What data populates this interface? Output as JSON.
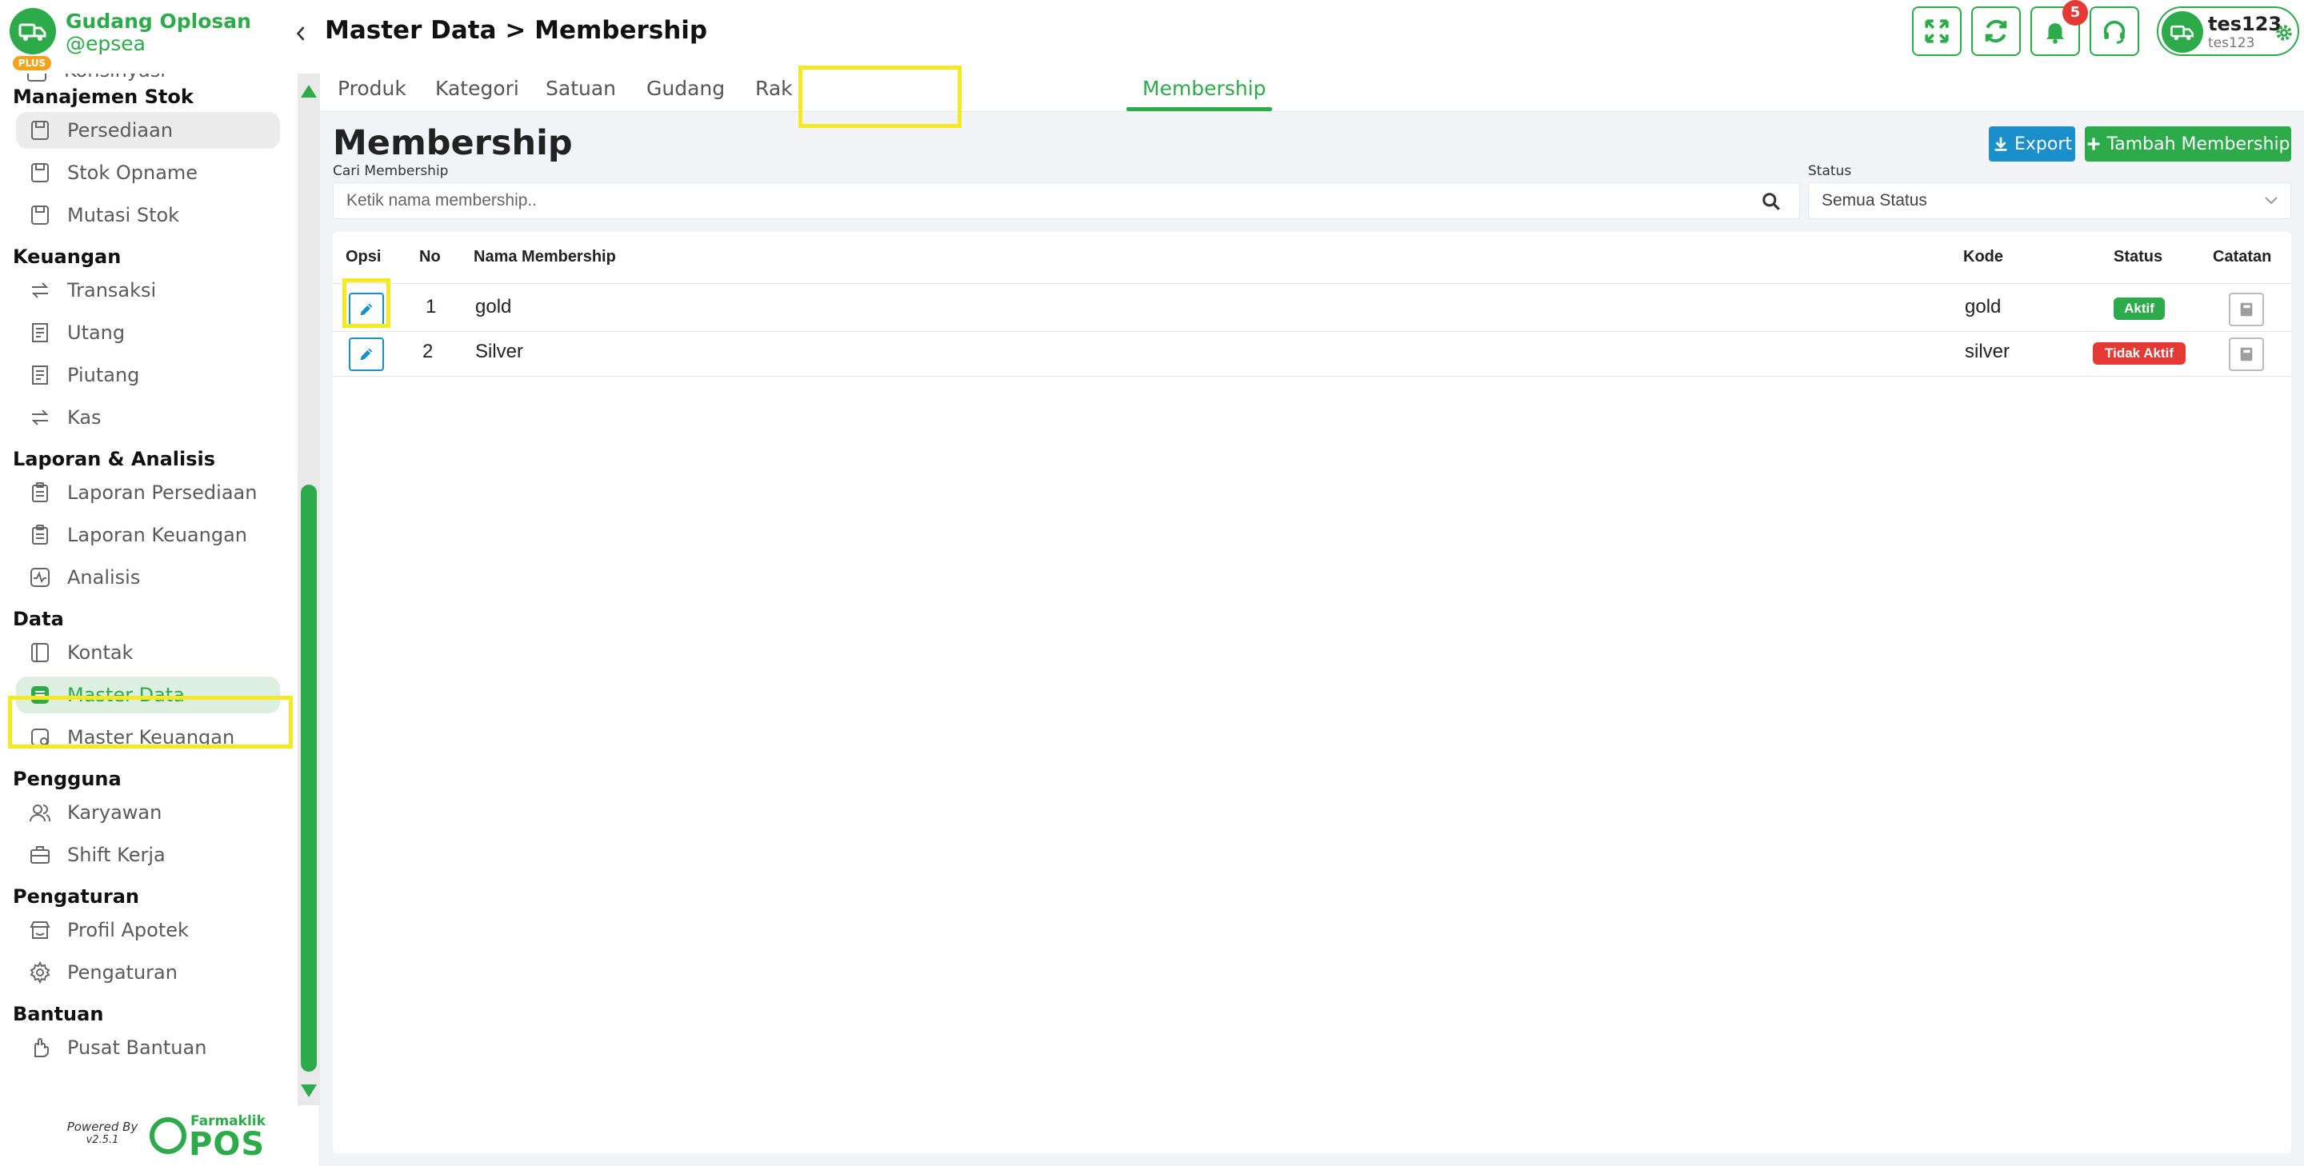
{
  "brand": {
    "name": "Gudang Oplosan",
    "handle": "@epsea",
    "plan": "PLUS"
  },
  "sidebar": {
    "partial_item": "Konsinyasi",
    "sections": [
      {
        "title": "Manajemen Stok",
        "items": [
          {
            "label": "Persediaan",
            "icon": "save-icon",
            "state": "hover"
          },
          {
            "label": "Stok Opname",
            "icon": "save-icon"
          },
          {
            "label": "Mutasi Stok",
            "icon": "save-icon"
          }
        ]
      },
      {
        "title": "Keuangan",
        "items": [
          {
            "label": "Transaksi",
            "icon": "transfer-icon"
          },
          {
            "label": "Utang",
            "icon": "receipt-icon"
          },
          {
            "label": "Piutang",
            "icon": "receipt-icon"
          },
          {
            "label": "Kas",
            "icon": "transfer-icon"
          }
        ]
      },
      {
        "title": "Laporan & Analisis",
        "items": [
          {
            "label": "Laporan Persediaan",
            "icon": "clipboard-icon"
          },
          {
            "label": "Laporan Keuangan",
            "icon": "clipboard-icon"
          },
          {
            "label": "Analisis",
            "icon": "activity-icon"
          }
        ]
      },
      {
        "title": "Data",
        "items": [
          {
            "label": "Kontak",
            "icon": "contact-book-icon"
          },
          {
            "label": "Master Data",
            "icon": "database-icon",
            "state": "active"
          },
          {
            "label": "Master Keuangan",
            "icon": "wallet-icon"
          }
        ]
      },
      {
        "title": "Pengguna",
        "items": [
          {
            "label": "Karyawan",
            "icon": "users-icon"
          },
          {
            "label": "Shift Kerja",
            "icon": "briefcase-icon"
          }
        ]
      },
      {
        "title": "Pengaturan",
        "items": [
          {
            "label": "Profil Apotek",
            "icon": "store-icon"
          },
          {
            "label": "Pengaturan",
            "icon": "gear-icon"
          }
        ]
      },
      {
        "title": "Bantuan",
        "items": [
          {
            "label": "Pusat Bantuan",
            "icon": "hand-icon"
          }
        ]
      }
    ],
    "powered_by": "Powered By",
    "version": "v2.5.1",
    "partner_small": "Farmaklik",
    "partner_big": "POS"
  },
  "header": {
    "title": "Master Data > Membership",
    "notification_count": "5",
    "user_name": "tes123",
    "user_sub": "tes123"
  },
  "tabs": [
    {
      "label": "Produk"
    },
    {
      "label": "Kategori"
    },
    {
      "label": "Satuan"
    },
    {
      "label": "Gudang"
    },
    {
      "label": "Rak"
    },
    {
      "label": "Membership",
      "active": true
    }
  ],
  "main": {
    "title": "Membership",
    "export_label": "Export",
    "add_label": "Tambah Membership",
    "search_label": "Cari Membership",
    "search_placeholder": "Ketik nama membership..",
    "status_label": "Status",
    "status_value": "Semua Status"
  },
  "table": {
    "columns": [
      "Opsi",
      "No",
      "Nama Membership",
      "Kode",
      "Status",
      "Catatan"
    ],
    "rows": [
      {
        "no": "1",
        "name": "gold",
        "code": "gold",
        "status": "Aktif",
        "status_color": "#2daa4a"
      },
      {
        "no": "2",
        "name": "Silver",
        "code": "silver",
        "status": "Tidak Aktif",
        "status_color": "#e53935"
      }
    ]
  },
  "colors": {
    "accent": "#2daa4a",
    "info": "#1a8fc9",
    "danger": "#e53935",
    "highlight": "#f5e924"
  }
}
